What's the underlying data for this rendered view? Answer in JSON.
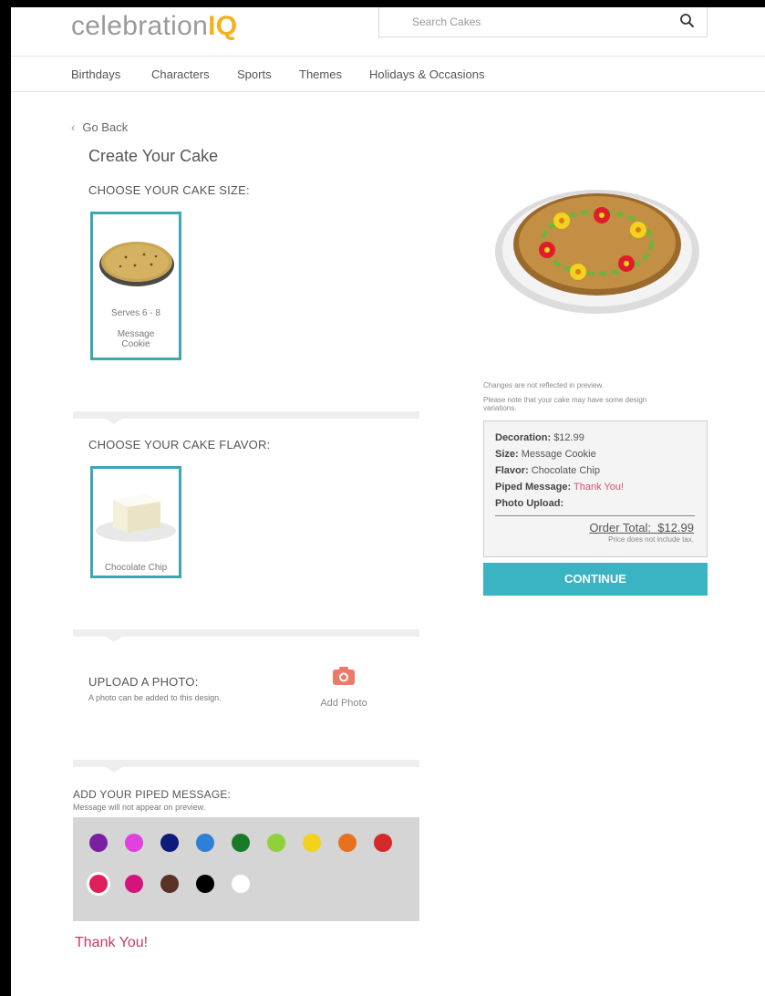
{
  "header": {
    "logo_main": "celebration",
    "logo_accent": "IQ",
    "search_placeholder": "Search Cakes"
  },
  "nav": {
    "items": [
      {
        "label": "Birthdays"
      },
      {
        "label": "Characters"
      },
      {
        "label": "Sports"
      },
      {
        "label": "Themes"
      },
      {
        "label": "Holidays & Occasions"
      }
    ]
  },
  "page": {
    "back_label": "Go Back",
    "title": "Create Your Cake"
  },
  "size_section": {
    "label": "CHOOSE YOUR CAKE SIZE:",
    "option": {
      "serves": "Serves 6 - 8",
      "name_line1": "Message",
      "name_line2": "Cookie"
    }
  },
  "flavor_section": {
    "label": "CHOOSE YOUR CAKE FLAVOR:",
    "option": {
      "name": "Chocolate Chip"
    }
  },
  "photo_section": {
    "label": "UPLOAD A PHOTO:",
    "sub": "A photo can be added to this design.",
    "button_label": "Add Photo"
  },
  "message_section": {
    "label": "ADD YOUR PIPED MESSAGE:",
    "sub": "Message will not appear on preview.",
    "value": "Thank You!",
    "colors": [
      "#7b1fa2",
      "#e040e0",
      "#0d1b7a",
      "#2d7fd8",
      "#1b7a2a",
      "#8ed13a",
      "#f2d21b",
      "#e8711f",
      "#d42a2a",
      "#e01e5a",
      "#d4147d",
      "#5a3225",
      "#000000",
      "#ffffff"
    ],
    "selected_color": "#e01e5a"
  },
  "preview": {
    "note1": "Changes are not reflected in preview.",
    "note2_line1": "Please note that your cake may have some design",
    "note2_line2": "variations."
  },
  "summary": {
    "decoration_label": "Decoration:",
    "decoration_value": "$12.99",
    "size_label": "Size:",
    "size_value": "Message Cookie",
    "flavor_label": "Flavor:",
    "flavor_value": "Chocolate Chip",
    "message_label": "Piped Message:",
    "message_value": "Thank You!",
    "photo_label": "Photo Upload:",
    "total_label": "Order Total:",
    "total_value": "$12.99",
    "tax_note": "Price does not include tax."
  },
  "continue_label": "CONTINUE"
}
